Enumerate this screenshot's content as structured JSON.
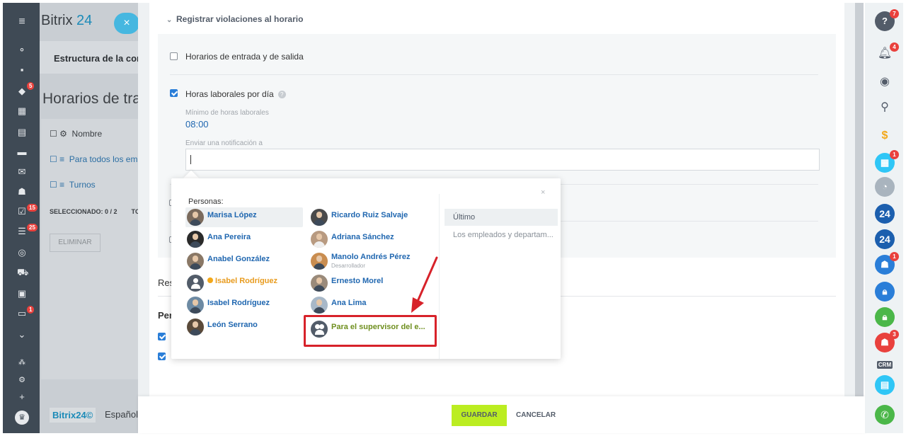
{
  "background_app": {
    "logo_text": "Bitrix",
    "logo_suffix": "24",
    "close_glyph": "×",
    "card_title": "Estructura de la com",
    "page_title": "Horarios de tra",
    "table": {
      "header": "Nombre",
      "rows": [
        "Para todos los em",
        "Turnos"
      ],
      "selected": "SELECCIONADO: 0 / 2",
      "selected_suffix": "TC",
      "delete_button": "ELIMINAR"
    },
    "footer": {
      "logo": "Bitrix24©",
      "language": "Español"
    }
  },
  "left_sidebar": {
    "badges": {
      "chat": "5",
      "tasks": "15",
      "feed": "25",
      "other": "1"
    }
  },
  "panel": {
    "section_title": "Registrar violaciones al horario",
    "options": {
      "entry_exit": "Horarios de entrada y de salida",
      "hours_per_day": "Horas laborales por día"
    },
    "min_hours_label": "Mínimo de horas laborales",
    "min_hours_value": "08:00",
    "notify_label": "Enviar una notificación a",
    "partial_labels": {
      "res": "Res",
      "per": "Per"
    }
  },
  "popup": {
    "people_title": "Personas:",
    "close_glyph": "×",
    "people_left": [
      {
        "name": "Marisa López",
        "selected": true
      },
      {
        "name": "Ana Pereira"
      },
      {
        "name": "Anabel González"
      },
      {
        "name": "Isabel Rodríguez",
        "style": "extranet"
      },
      {
        "name": "Isabel Rodríguez"
      },
      {
        "name": "León Serrano"
      }
    ],
    "people_right": [
      {
        "name": "Ricardo Ruiz Salvaje"
      },
      {
        "name": "Adriana Sánchez"
      },
      {
        "name": "Manolo Andrés Pérez",
        "subtitle": "Desarrollador"
      },
      {
        "name": "Ernesto Morel"
      },
      {
        "name": "Ana Lima"
      },
      {
        "name": "Para el supervisor del e...",
        "style": "group"
      }
    ],
    "tabs": [
      {
        "label": "Último",
        "active": true
      },
      {
        "label": "Los empleados y departam...",
        "active": false
      }
    ]
  },
  "footer": {
    "save": "GUARDAR",
    "cancel": "CANCELAR"
  },
  "right_sidebar": {
    "badges": {
      "help": "7",
      "notifications": "4",
      "calendar": "1",
      "group1": "1",
      "group3": "3"
    },
    "b24_label": "24",
    "crm_label": "CRM"
  },
  "colors": {
    "accent_blue": "#2067b0",
    "save_green": "#bbed21",
    "highlight_red": "#d7222a",
    "badge_red": "#e9413d"
  }
}
